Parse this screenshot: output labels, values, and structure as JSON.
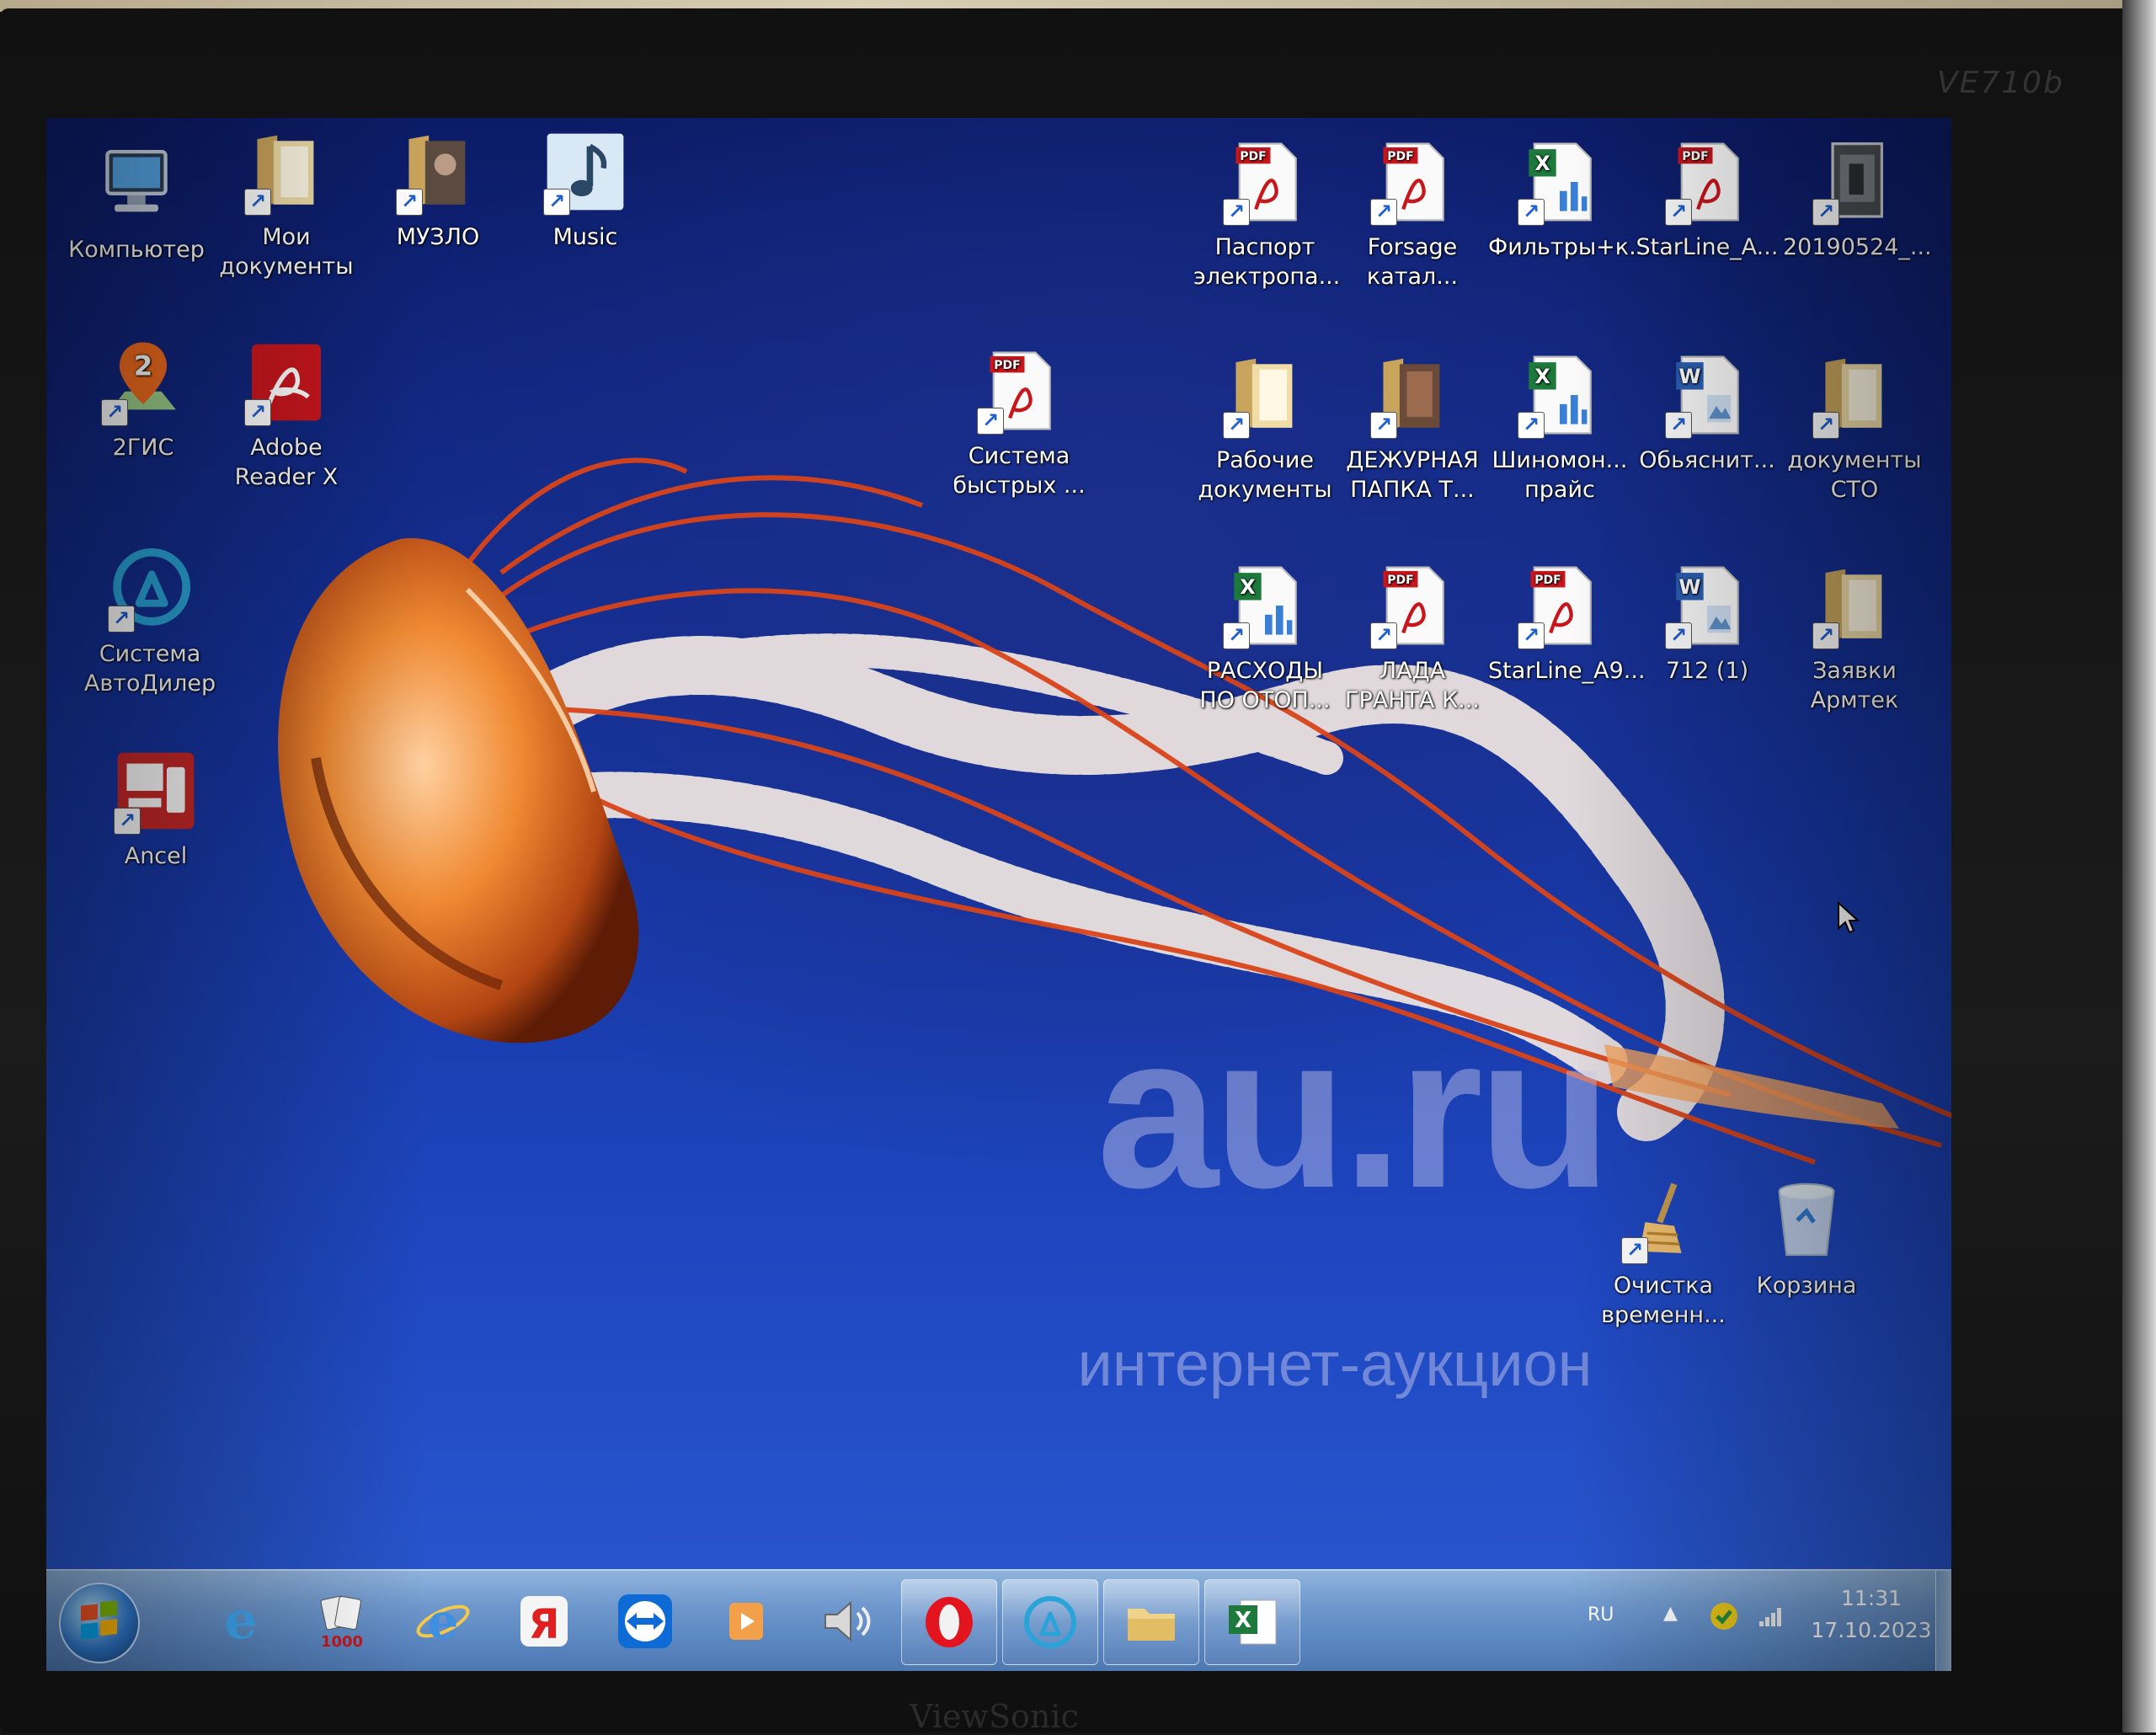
{
  "monitor": {
    "model": "VE710b",
    "brand": "ViewSonic"
  },
  "desktop_icons": [
    {
      "label": "Компьютер",
      "icon": "computer-icon"
    },
    {
      "label": "Мои\nдокументы",
      "icon": "folder-icon"
    },
    {
      "label": "МУЗЛО",
      "icon": "folder-icon"
    },
    {
      "label": "Music",
      "icon": "music-note-icon"
    },
    {
      "label": "Паспорт\nэлектропа...",
      "icon": "pdf-icon"
    },
    {
      "label": "Forsage\nкатал...",
      "icon": "pdf-icon"
    },
    {
      "label": "Фильтры+к...",
      "icon": "excel-icon"
    },
    {
      "label": "StarLine_A...",
      "icon": "pdf-icon"
    },
    {
      "label": "20190524_...",
      "icon": "image-icon"
    },
    {
      "label": "2ГИС",
      "icon": "map-pin-icon"
    },
    {
      "label": "Adobe\nReader X",
      "icon": "adobe-reader-icon"
    },
    {
      "label": "Система\nбыстрых ...",
      "icon": "pdf-icon"
    },
    {
      "label": "Рабочие\nдокументы",
      "icon": "folder-icon"
    },
    {
      "label": "ДЕЖУРНАЯ\nПАПКА Т...",
      "icon": "folder-icon"
    },
    {
      "label": "Шиномон...\nпрайс",
      "icon": "excel-icon"
    },
    {
      "label": "Обьяснит...",
      "icon": "word-icon"
    },
    {
      "label": "документы\nСТО",
      "icon": "folder-icon"
    },
    {
      "label": "Система\nАвтоДилер",
      "icon": "autodealer-icon"
    },
    {
      "label": "РАСХОДЫ\nПО ОТОП...",
      "icon": "excel-icon"
    },
    {
      "label": "ЛАДА\nГРАНТА К...",
      "icon": "pdf-icon"
    },
    {
      "label": "StarLine_A9...",
      "icon": "pdf-icon"
    },
    {
      "label": "712 (1)",
      "icon": "word-icon"
    },
    {
      "label": "Заявки\nАрмтек",
      "icon": "folder-icon"
    },
    {
      "label": "Ancel",
      "icon": "ancel-icon"
    },
    {
      "label": "Очистка\nвременн...",
      "icon": "broom-icon"
    },
    {
      "label": "Корзина",
      "icon": "recycle-bin-icon"
    }
  ],
  "watermark": {
    "main": "au.ru",
    "sub": "интернет-аукцион"
  },
  "taskbar": {
    "items": [
      "ie-icon",
      "solitaire-1000-icon",
      "ie-icon",
      "yandex-browser-icon",
      "teamviewer-icon",
      "media-player-icon",
      "volume-icon",
      "opera-icon",
      "autodealer-icon",
      "folder-icon",
      "excel-icon"
    ],
    "pinned_label_yandex": "Я",
    "solitaire_label": "1000",
    "tray": {
      "lang": "RU",
      "chevron": "▲",
      "time": "11:31",
      "date": "17.10.2023"
    }
  },
  "colors": {
    "pdf_red": "#c8161d",
    "excel_green": "#1e7a3c",
    "word_blue": "#2b5fb4",
    "folder_tan": "#e6c87a"
  }
}
